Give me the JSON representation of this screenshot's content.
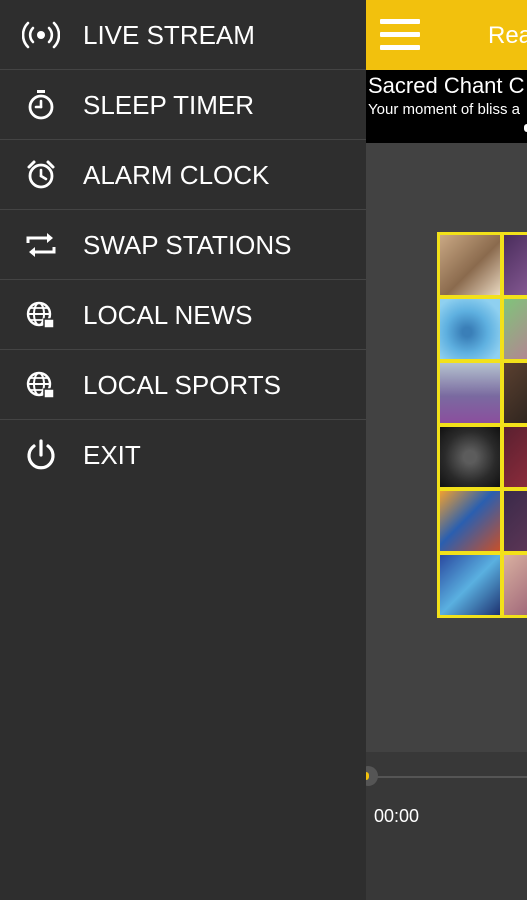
{
  "drawer": {
    "items": [
      {
        "label": "LIVE STREAM",
        "icon": "broadcast-icon"
      },
      {
        "label": "SLEEP TIMER",
        "icon": "stopwatch-icon"
      },
      {
        "label": "ALARM CLOCK",
        "icon": "alarm-clock-icon"
      },
      {
        "label": "SWAP STATIONS",
        "icon": "swap-icon"
      },
      {
        "label": "LOCAL NEWS",
        "icon": "globe-icon"
      },
      {
        "label": "LOCAL SPORTS",
        "icon": "globe-icon"
      },
      {
        "label": "EXIT",
        "icon": "power-icon"
      }
    ]
  },
  "header": {
    "title": "Rea",
    "menu_icon": "hamburger-menu-icon"
  },
  "now_playing": {
    "title": "Sacred Chant C",
    "subtitle": "Your moment of bliss a"
  },
  "player": {
    "elapsed": "00:00",
    "progress": 0
  },
  "colors": {
    "accent": "#f2c10d",
    "drawer_bg": "#2e2e2e",
    "content_bg": "#424242",
    "art_border": "#f2e11a"
  }
}
